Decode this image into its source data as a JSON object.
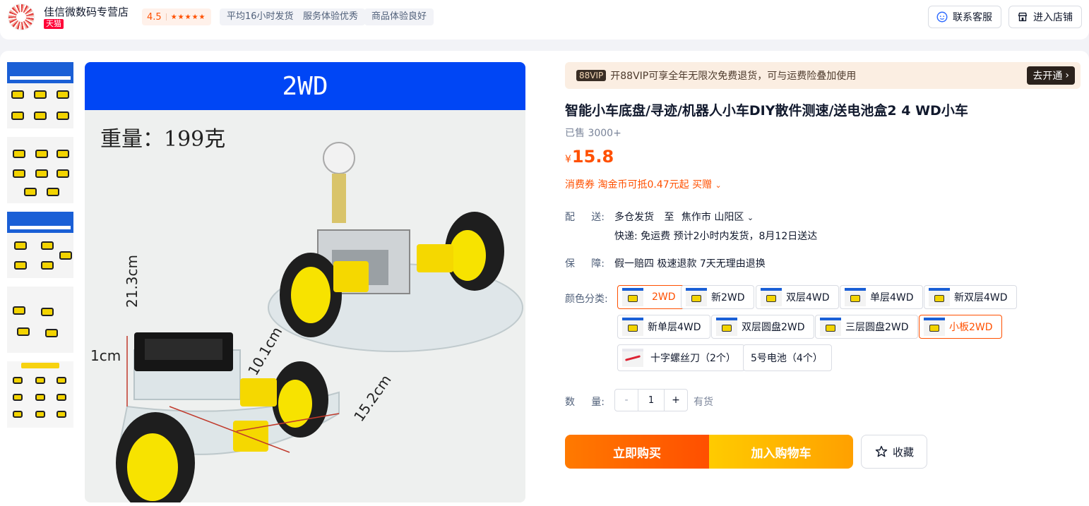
{
  "shop": {
    "name": "佳信微数码专营店",
    "platform_tag": "天猫",
    "rating": "4.5",
    "stars": "★★★★★",
    "chips": [
      "平均16小时发货",
      "服务体验优秀",
      "商品体验良好"
    ],
    "contact_label": "联系客服",
    "enter_store_label": "进入店铺"
  },
  "gallery": {
    "hero_band_text": "2WD",
    "hero_weight_text": "重量：199克",
    "dimensions": [
      "21.3cm",
      "1cm",
      "10.1cm",
      "15.2cm"
    ]
  },
  "vip": {
    "tag": "88VIP",
    "text": "开88VIP可享全年无限次免费退货，可与运费险叠加使用",
    "button": "去开通"
  },
  "product": {
    "title": "智能小车底盘/寻迹/机器人小车DIY散件测速/送电池盒2 4 WD小车",
    "sold": "已售 3000+",
    "currency": "¥",
    "price": "15.8",
    "coupon": "消费券 淘金币可抵0.47元起 买赠"
  },
  "delivery": {
    "label_a": "配",
    "label_b": "送:",
    "origin": "多仓发货",
    "to": "至",
    "destination": "焦作市 山阳区",
    "detail": "快递: 免运费  预计2小时内发货，8月12日送达"
  },
  "guarantee": {
    "label_a": "保",
    "label_b": "障:",
    "text": "假一赔四 极速退款 7天无理由退换"
  },
  "sku": {
    "label": "颜色分类:",
    "options": [
      {
        "label": "2WD",
        "selected": true
      },
      {
        "label": "新2WD",
        "selected": false
      },
      {
        "label": "双层4WD",
        "selected": false
      },
      {
        "label": "单层4WD",
        "selected": false
      },
      {
        "label": "新双层4WD",
        "selected": false
      },
      {
        "label": "新单层4WD",
        "selected": false
      },
      {
        "label": "双层圆盘2WD",
        "selected": false
      },
      {
        "label": "三层圆盘2WD",
        "selected": false
      },
      {
        "label": "小板2WD",
        "selected": true
      },
      {
        "label": "十字螺丝刀（2个）",
        "selected": false
      },
      {
        "label": "5号电池（4个）",
        "selected": false
      }
    ]
  },
  "quantity": {
    "label_a": "数",
    "label_b": "量:",
    "minus": "-",
    "value": "1",
    "plus": "+",
    "stock": "有货"
  },
  "actions": {
    "buy_now": "立即购买",
    "add_cart": "加入购物车",
    "favorite": "收藏"
  },
  "colors": {
    "accent": "#ff5000",
    "tmall": "#ff0036",
    "hero_band": "#0046f5"
  }
}
